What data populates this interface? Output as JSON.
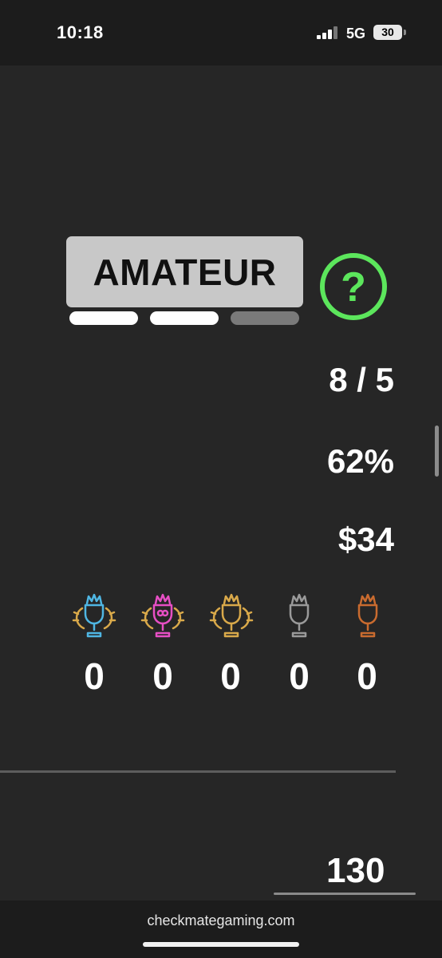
{
  "status_bar": {
    "time": "10:18",
    "network": "5G",
    "battery": "30"
  },
  "rank": {
    "label": "AMATEUR",
    "progress": {
      "filled": 2,
      "total": 3
    },
    "help_icon": "question-circle-icon",
    "help_color": "#5ce65c"
  },
  "stats": {
    "record": "8 / 5",
    "percentage": "62%",
    "earnings": "$34"
  },
  "trophies": [
    {
      "icon": "trophy-blue-icon",
      "color": "#4fb6e3",
      "count": "0"
    },
    {
      "icon": "trophy-pink-icon",
      "color": "#e74fc4",
      "count": "0"
    },
    {
      "icon": "trophy-gold-icon",
      "color": "#d9a94a",
      "count": "0"
    },
    {
      "icon": "trophy-silver-icon",
      "color": "#9a9a9a",
      "count": "0"
    },
    {
      "icon": "trophy-bronze-icon",
      "color": "#c96b2f",
      "count": "0"
    }
  ],
  "footer_value": "130",
  "browser": {
    "url": "checkmategaming.com"
  }
}
